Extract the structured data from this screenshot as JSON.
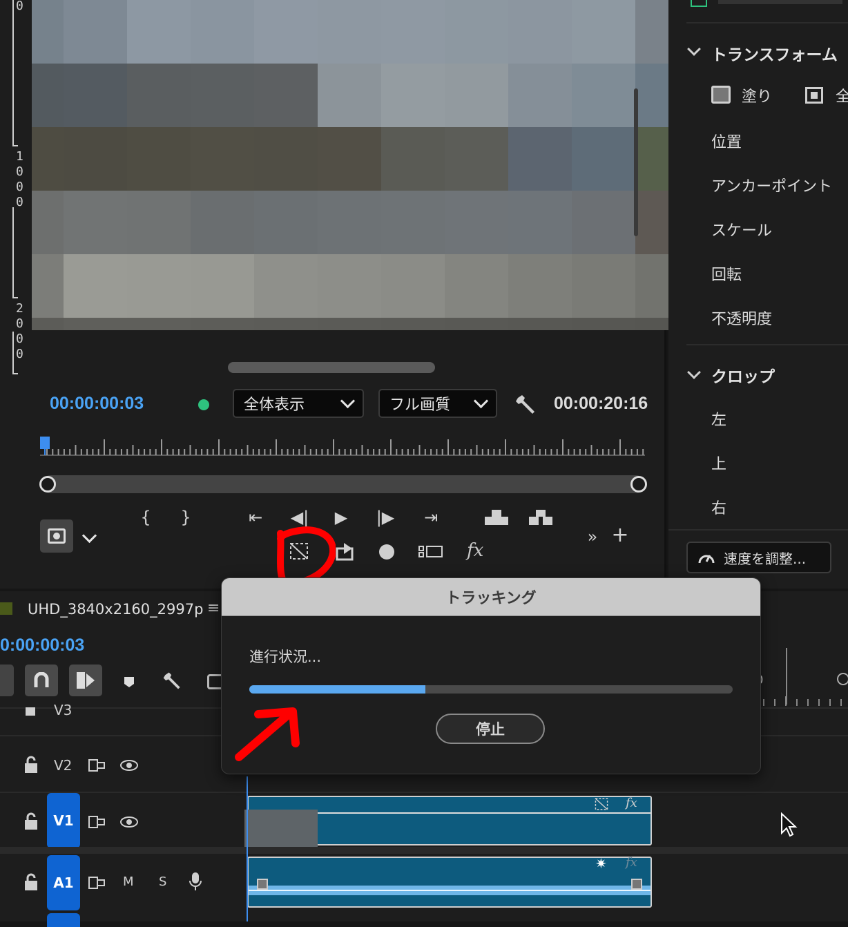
{
  "monitor": {
    "ruler_digits": [
      "0",
      "1",
      "0",
      "0",
      "0",
      "2",
      "0",
      "0",
      "0"
    ],
    "current_timecode": "00:00:00:03",
    "zoom_select": "全体表示",
    "quality_select": "フル画質",
    "duration_timecode": "00:00:20:16",
    "status_dot_color": "#2ec27e"
  },
  "effects": {
    "sections": [
      {
        "label": "トランスフォーム"
      },
      {
        "label": "クロップ"
      }
    ],
    "fill_label": "塗り",
    "fill_label_2": "全",
    "transform_items": [
      "位置",
      "アンカーポイント",
      "スケール",
      "回転",
      "不透明度"
    ],
    "crop_items": [
      "左",
      "上",
      "右"
    ],
    "speed_button": "速度を調整..."
  },
  "timeline": {
    "sequence_name": "UHD_3840x2160_2997p",
    "timecode": "0:00:00:03",
    "tracks": [
      {
        "id": "V3",
        "label": "V3"
      },
      {
        "id": "V2",
        "label": "V2"
      },
      {
        "id": "V1",
        "label": "V1"
      },
      {
        "id": "A1",
        "label": "A1",
        "m": "M",
        "s": "S"
      }
    ],
    "ruler_partial": "0"
  },
  "dialog": {
    "title": "トラッキング",
    "status": "進行状況...",
    "progress": 0.364,
    "stop_label": "停止"
  },
  "colors": {
    "accent": "#4aa3f5",
    "track_badge": "#0f64d2",
    "clip_fill": "#0d5b7e",
    "annotation": "#ff0000"
  }
}
